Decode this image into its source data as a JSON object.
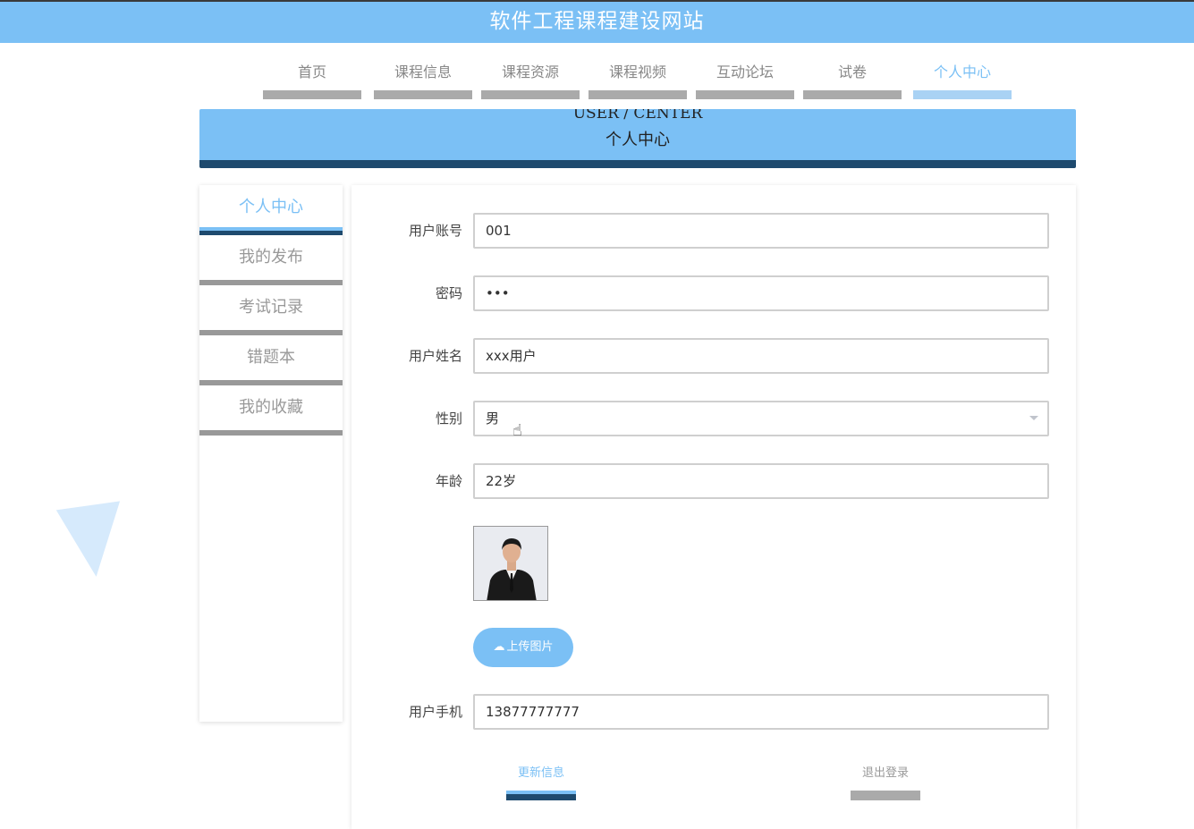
{
  "site": {
    "title": "软件工程课程建设网站"
  },
  "nav": {
    "items": [
      {
        "label": "首页"
      },
      {
        "label": "课程信息"
      },
      {
        "label": "课程资源"
      },
      {
        "label": "课程视频"
      },
      {
        "label": "互动论坛"
      },
      {
        "label": "试卷"
      },
      {
        "label": "个人中心",
        "active": true
      }
    ]
  },
  "banner": {
    "en": "USER / CENTER",
    "cn": "个人中心"
  },
  "sidebar": {
    "items": [
      {
        "label": "个人中心",
        "active": true
      },
      {
        "label": "我的发布"
      },
      {
        "label": "考试记录"
      },
      {
        "label": "错题本"
      },
      {
        "label": "我的收藏"
      }
    ]
  },
  "form": {
    "account": {
      "label": "用户账号",
      "value": "001"
    },
    "password": {
      "label": "密码",
      "value": "•••"
    },
    "name": {
      "label": "用户姓名",
      "value": "xxx用户"
    },
    "gender": {
      "label": "性别",
      "value": "男"
    },
    "age": {
      "label": "年龄",
      "value": "22岁"
    },
    "upload_label": "上传图片",
    "phone": {
      "label": "用户手机",
      "value": "13877777777"
    }
  },
  "actions": {
    "update": "更新信息",
    "logout": "退出登录"
  },
  "colors": {
    "primary": "#7bc0f5",
    "dark": "#1e4a6e",
    "muted": "#aaaaaa"
  },
  "icons": {
    "upload": "cloud-upload-icon",
    "cursor": "hand-pointer-icon",
    "select": "chevron-down-icon"
  }
}
